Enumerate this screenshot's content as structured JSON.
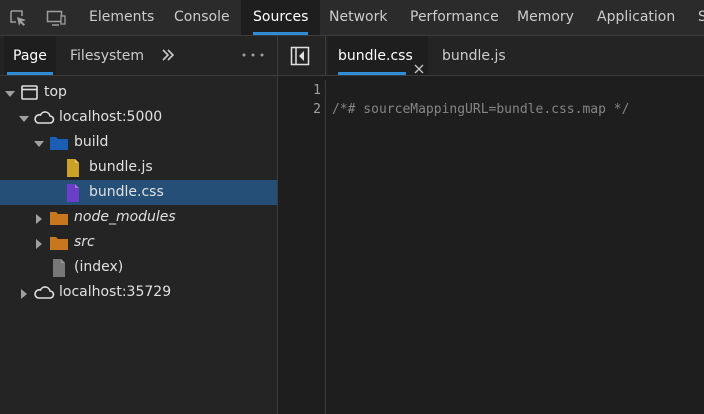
{
  "toolbar": {
    "inspect_icon": "inspect-element-icon",
    "device_icon": "device-toolbar-icon",
    "tabs": [
      {
        "label": "Elements"
      },
      {
        "label": "Console"
      },
      {
        "label": "Sources",
        "active": true
      },
      {
        "label": "Network"
      },
      {
        "label": "Performance"
      },
      {
        "label": "Memory"
      },
      {
        "label": "Application"
      },
      {
        "label": "S"
      }
    ]
  },
  "navigator": {
    "tabs": [
      {
        "label": "Page",
        "active": true
      },
      {
        "label": "Filesystem"
      }
    ],
    "more_tabs_icon": "double-chevron-right-icon",
    "menu_icon": "more-options-icon",
    "tree": [
      {
        "label": "top",
        "icon": "frame-icon",
        "expanded": true
      },
      {
        "label": "localhost:5000",
        "icon": "cloud-icon",
        "expanded": true
      },
      {
        "label": "build",
        "icon": "folder-icon",
        "color": "#1a5fb4",
        "expanded": true
      },
      {
        "label": "bundle.js",
        "icon": "js-file-icon",
        "color": "#c9a227"
      },
      {
        "label": "bundle.css",
        "icon": "css-file-icon",
        "color": "#6a3fc8",
        "selected": true
      },
      {
        "label": "node_modules",
        "icon": "folder-icon",
        "color": "#c8771e",
        "italic": true
      },
      {
        "label": "src",
        "icon": "folder-icon",
        "color": "#c8771e",
        "italic": true
      },
      {
        "label": "(index)",
        "icon": "document-icon",
        "color": "#777777"
      },
      {
        "label": "localhost:35729",
        "icon": "cloud-icon",
        "expanded": false
      }
    ]
  },
  "editor": {
    "toggle_icon": "toggle-navigator-icon",
    "tabs": [
      {
        "label": "bundle.css",
        "active": true,
        "close_icon": "close-icon"
      },
      {
        "label": "bundle.js"
      }
    ],
    "line_numbers": [
      "1",
      "2"
    ],
    "lines": [
      "",
      "/*# sourceMappingURL=bundle.css.map */"
    ]
  },
  "colors": {
    "accent": "#2f8cd6",
    "selection": "#264f78"
  }
}
